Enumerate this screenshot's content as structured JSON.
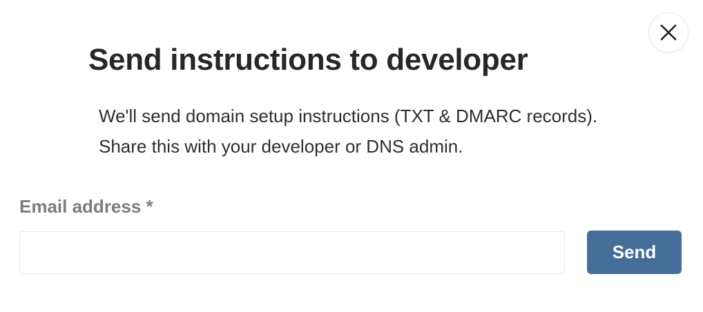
{
  "dialog": {
    "title": "Send instructions to developer",
    "description": "We'll send domain setup instructions (TXT & DMARC records). Share this with your developer or DNS admin.",
    "close_icon": "close-icon"
  },
  "form": {
    "email_label": "Email address *",
    "email_value": "",
    "email_placeholder": "",
    "send_label": "Send"
  },
  "colors": {
    "primary_button": "#456d97",
    "title_text": "#26272b",
    "label_text": "#7c7c80"
  }
}
